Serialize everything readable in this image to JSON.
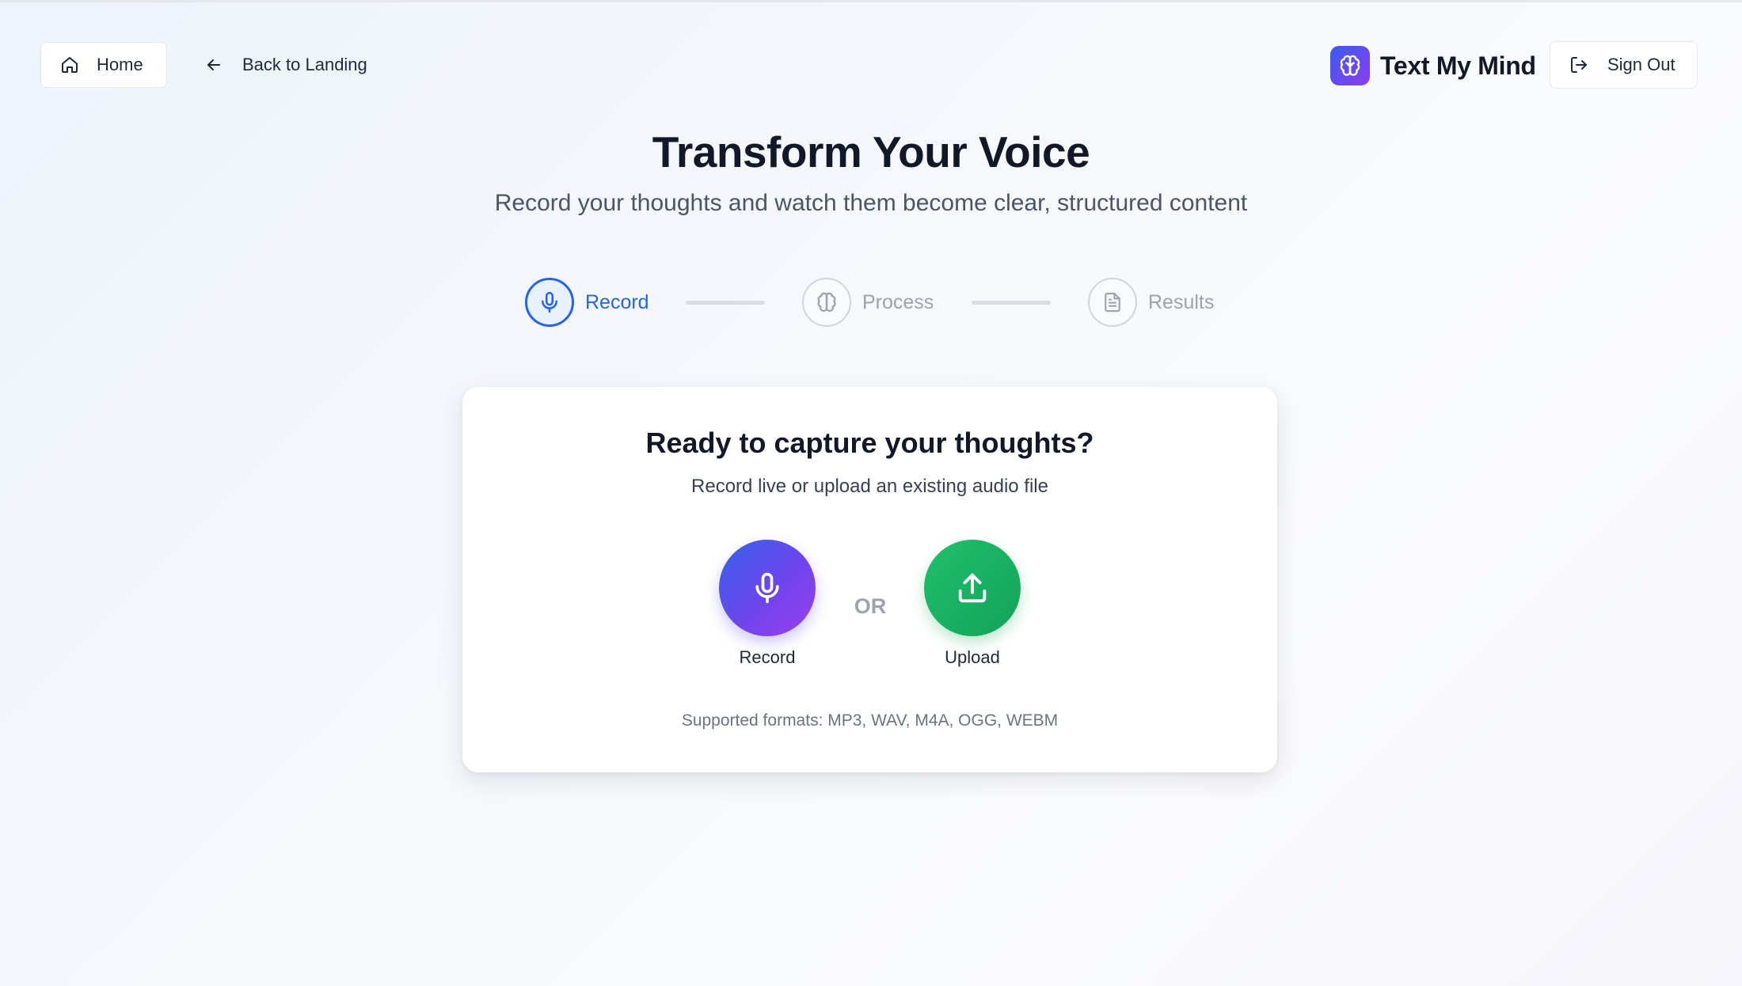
{
  "header": {
    "home_label": "Home",
    "back_label": "Back to Landing",
    "brand_name": "Text My Mind",
    "signout_label": "Sign Out"
  },
  "hero": {
    "title": "Transform Your Voice",
    "subtitle": "Record your thoughts and watch them become clear, structured content"
  },
  "steps": [
    {
      "label": "Record",
      "icon": "mic-icon",
      "state": "active"
    },
    {
      "label": "Process",
      "icon": "brain-icon",
      "state": "inactive"
    },
    {
      "label": "Results",
      "icon": "document-icon",
      "state": "inactive"
    }
  ],
  "card": {
    "title": "Ready to capture your thoughts?",
    "subtitle": "Record live or upload an existing audio file",
    "record_label": "Record",
    "or_label": "OR",
    "upload_label": "Upload",
    "formats": "Supported formats: MP3, WAV, M4A, OGG, WEBM"
  },
  "colors": {
    "accent": "#2563eb",
    "record_gradient_start": "#3563ea",
    "record_gradient_end": "#9b3ff0",
    "upload_green": "#16a34a",
    "inactive": "#9ca3af"
  }
}
